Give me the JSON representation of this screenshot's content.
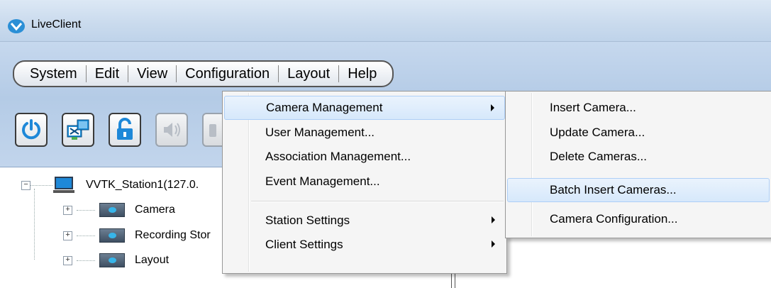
{
  "window": {
    "title": "LiveClient"
  },
  "menubar": {
    "items": [
      "System",
      "Edit",
      "View",
      "Configuration",
      "Layout",
      "Help"
    ]
  },
  "toolbar": {
    "buttons": [
      {
        "icon": "power-icon",
        "enabled": true
      },
      {
        "icon": "network-settings-icon",
        "enabled": true
      },
      {
        "icon": "unlock-icon",
        "enabled": true
      },
      {
        "icon": "speaker-icon",
        "enabled": false
      },
      {
        "icon": "unknown-tool-icon",
        "enabled": false
      }
    ]
  },
  "tree": {
    "root": "VVTK_Station1(127.0.",
    "children": [
      "Camera",
      "Recording Stor",
      "Layout"
    ]
  },
  "configuration_menu": {
    "items": [
      {
        "label": "Camera Management",
        "submenu": true,
        "highlighted": true
      },
      {
        "label": "User Management...",
        "submenu": false
      },
      {
        "label": "Association Management...",
        "submenu": false
      },
      {
        "label": "Event Management...",
        "submenu": false
      },
      {
        "label": "Station Settings",
        "submenu": true
      },
      {
        "label": "Client Settings",
        "submenu": true
      }
    ]
  },
  "camera_submenu": {
    "items": [
      {
        "label": "Insert Camera..."
      },
      {
        "label": "Update Camera..."
      },
      {
        "label": "Delete Cameras..."
      },
      {
        "label": "Batch Insert Cameras...",
        "highlighted": true
      },
      {
        "label": "Camera Configuration..."
      }
    ]
  },
  "colors": {
    "title_bar": "#c9daed",
    "toolbar_bg": "#b4cbe6",
    "menu_bg": "#f5f5f5",
    "menu_highlight": "#d6e8fb",
    "power_icon": "#1e88d8",
    "folder_accent": "#37b5e9"
  }
}
